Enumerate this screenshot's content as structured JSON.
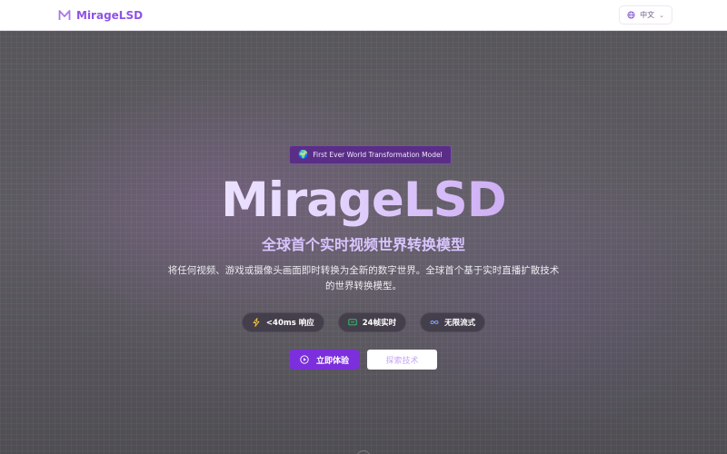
{
  "header": {
    "brand": "MirageLSD",
    "language": "中文"
  },
  "hero": {
    "badge": "First Ever World Transformation Model",
    "title": "MirageLSD",
    "subtitle": "全球首个实时视频世界转换模型",
    "description": "将任何视频、游戏或摄像头画面即时转换为全新的数字世界。全球首个基于实时直播扩散技术的世界转换模型。",
    "features": [
      {
        "label": "<40ms 响应",
        "icon": "lightning-icon",
        "color": "#f5c542"
      },
      {
        "label": "24帧实时",
        "icon": "monitor-icon",
        "color": "#37c97a"
      },
      {
        "label": "无限流式",
        "icon": "infinity-icon",
        "color": "#7aa3ff"
      }
    ],
    "primary_cta": "立即体验",
    "secondary_cta": "探索技术"
  },
  "colors": {
    "brand": "#8d54e6",
    "primary_button": "#7c2fdc",
    "accent_text": "#d9c4ff"
  }
}
